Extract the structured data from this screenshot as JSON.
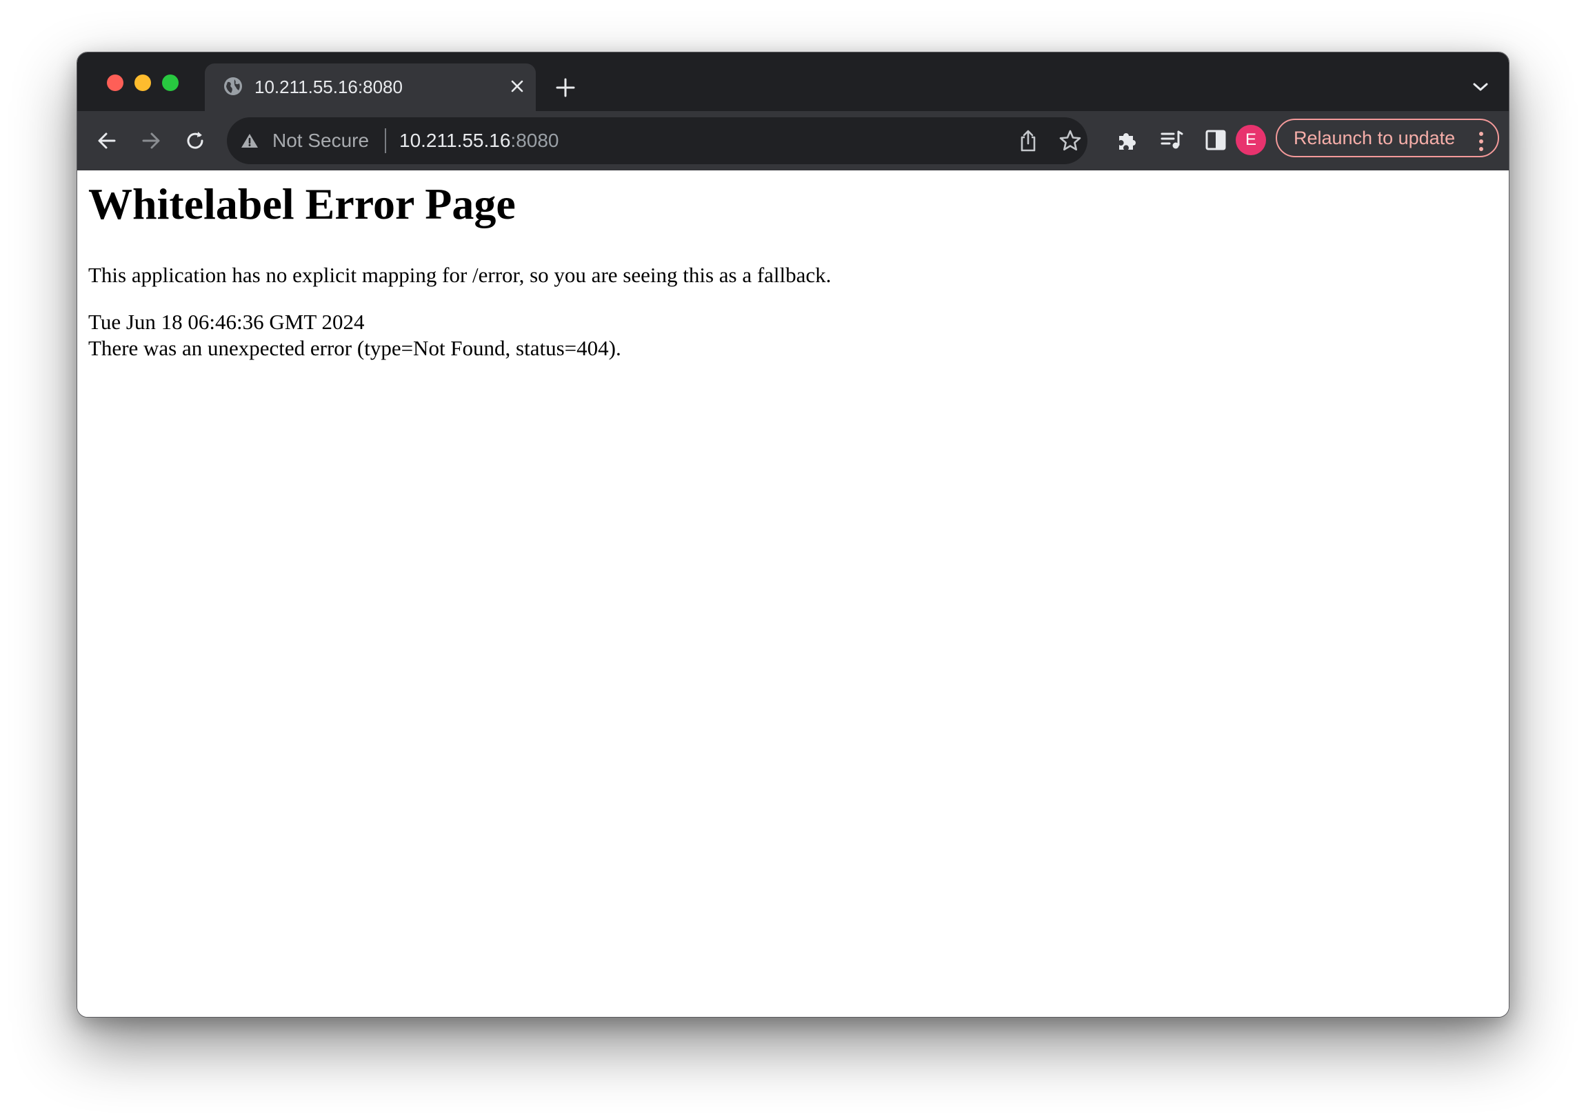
{
  "browser": {
    "tab": {
      "title": "10.211.55.16:8080",
      "favicon": "globe-icon"
    },
    "address_bar": {
      "security_label": "Not Secure",
      "url_host": "10.211.55.16",
      "url_port": ":8080"
    },
    "profile_initial": "E",
    "relaunch_label": "Relaunch to update",
    "icons": [
      "back-arrow-icon",
      "forward-arrow-icon",
      "reload-icon",
      "warning-triangle-icon",
      "share-icon",
      "star-icon",
      "puzzle-icon",
      "media-queue-icon",
      "side-panel-icon",
      "more-vert-icon",
      "close-icon",
      "plus-icon",
      "chevron-down-icon"
    ],
    "colors": {
      "titlebar": "#1f2023",
      "toolbar": "#35363a",
      "omnibox": "#202124",
      "avatar": "#e8336e",
      "relaunch_accent": "#f6aea9"
    }
  },
  "page": {
    "title": "Whitelabel Error Page",
    "description": "This application has no explicit mapping for /error, so you are seeing this as a fallback.",
    "timestamp": "Tue Jun 18 06:46:36 GMT 2024",
    "error_message": "There was an unexpected error (type=Not Found, status=404)."
  }
}
